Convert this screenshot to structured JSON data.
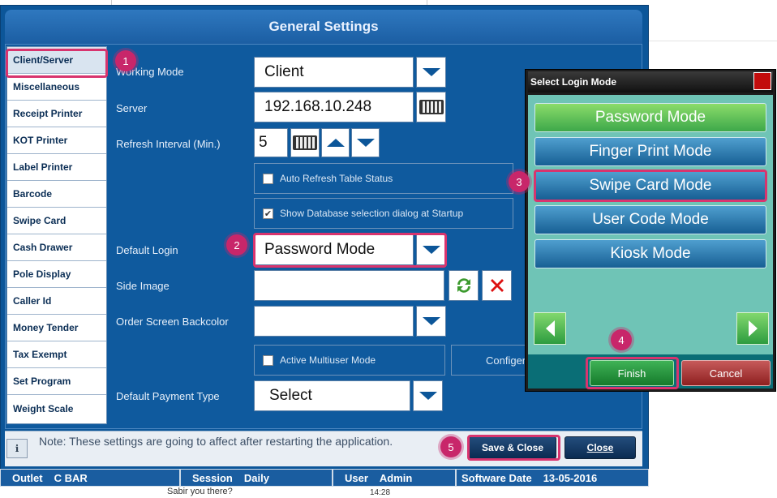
{
  "dialog": {
    "title": "General Settings"
  },
  "nav": {
    "items": [
      "Client/Server",
      "Miscellaneous",
      "Receipt Printer",
      "KOT Printer",
      "Label Printer",
      "Barcode",
      "Swipe Card",
      "Cash Drawer",
      "Pole Display",
      "Caller Id",
      "Money Tender",
      "Tax Exempt",
      "Set Program",
      "Weight Scale"
    ]
  },
  "form": {
    "working_mode_label": "Working Mode",
    "working_mode_value": "Client",
    "server_label": "Server",
    "server_value": "192.168.10.248",
    "refresh_label": "Refresh Interval (Min.)",
    "refresh_value": "5",
    "auto_refresh_label": "Auto Refresh Table Status",
    "show_db_label": "Show Database selection dialog at Startup",
    "default_login_label": "Default Login",
    "default_login_value": "Password Mode",
    "side_image_label": "Side Image",
    "order_backcolor_label": "Order Screen Backcolor",
    "multiuser_label": "Active Multiuser Mode",
    "configure_label": "Configer",
    "payment_label": "Default Payment Type",
    "payment_value": "Select"
  },
  "footer": {
    "note": "Note: These settings are going to affect after restarting the application.",
    "save_label": "Save & Close",
    "close_label": "Close"
  },
  "status": {
    "outlet_label": "Outlet",
    "outlet_value": "C BAR",
    "session_label": "Session",
    "session_value": "Daily",
    "user_label": "User",
    "user_value": "Admin",
    "date_label": "Software Date",
    "date_value": "13-05-2016"
  },
  "popup": {
    "title": "Select Login Mode",
    "modes": [
      "Password Mode",
      "Finger Print Mode",
      "Swipe Card Mode",
      "User Code Mode",
      "Kiosk Mode"
    ],
    "finish_label": "Finish",
    "cancel_label": "Cancel"
  },
  "badges": [
    "1",
    "2",
    "3",
    "4",
    "5"
  ],
  "background": {
    "chat_text": "Sabir you there?",
    "chat_time": "14:28"
  },
  "colors": {
    "accent_highlight": "#d8346e",
    "dialog_blue": "#0c5699",
    "selected_green": "#3da84a"
  }
}
